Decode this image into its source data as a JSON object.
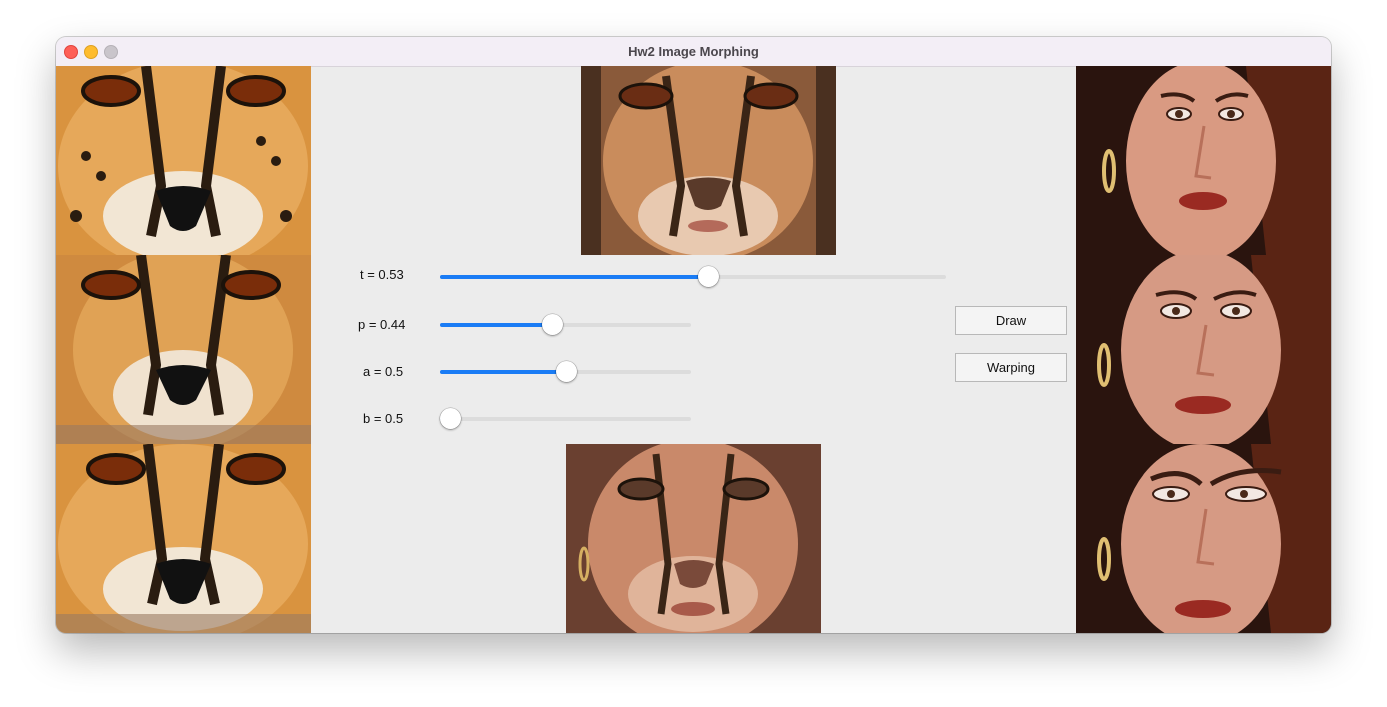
{
  "window": {
    "title": "Hw2 Image Morphing"
  },
  "images": {
    "source": [
      "cheetah face (original)",
      "cheetah face (warped)",
      "cheetah face (warped)"
    ],
    "target": [
      "woman face (original)",
      "woman face (warped)",
      "woman face (warped)"
    ],
    "morph_top": "morphed cheetah-woman face",
    "morph_bottom": "morphed woman-cheetah face"
  },
  "sliders": [
    {
      "label": "t = 0.53",
      "value": 0.53
    },
    {
      "label": "p = 0.44",
      "value": 0.44
    },
    {
      "label": "a = 0.5",
      "value": 0.5
    },
    {
      "label": "b = 0.5",
      "value": 0.0
    }
  ],
  "buttons": {
    "draw": "Draw",
    "warping": "Warping"
  },
  "colors": {
    "accent": "#1a7cf5",
    "track": "#dcdcdc"
  }
}
